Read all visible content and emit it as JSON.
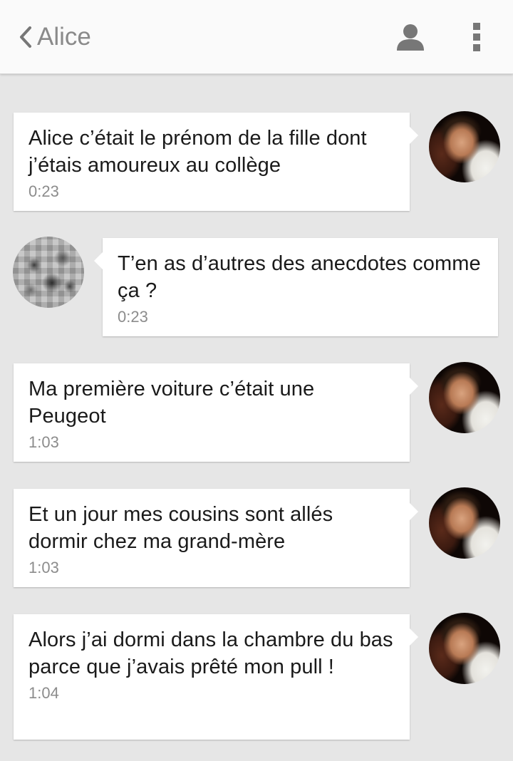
{
  "appbar": {
    "title": "Alice",
    "back_icon": "chevron-left-icon",
    "contact_icon": "person-icon",
    "menu_icon": "more-vert-icon",
    "icon_color": "#777777"
  },
  "messages": [
    {
      "sender": "me",
      "text": "Alice c’était le prénom de la fille dont j’étais amoureux au collège",
      "time": "0:23"
    },
    {
      "sender": "other",
      "text": "T’en as d’autres des anecdotes comme ça ?",
      "time": "0:23"
    },
    {
      "sender": "me",
      "text": "Ma première voiture c’était une Peugeot",
      "time": "1:03"
    },
    {
      "sender": "me",
      "text": "Et un jour mes cousins sont allés dormir chez ma grand-mère",
      "time": "1:03"
    },
    {
      "sender": "me",
      "text": "Alors j’ai dormi dans la chambre du bas parce que j’avais prêté mon pull !",
      "time": "1:04"
    }
  ],
  "colors": {
    "background": "#e6e6e6",
    "bubble": "#ffffff",
    "appbar": "#fafafa",
    "text": "#1a1a1a",
    "timestamp": "#8c8c8c"
  }
}
